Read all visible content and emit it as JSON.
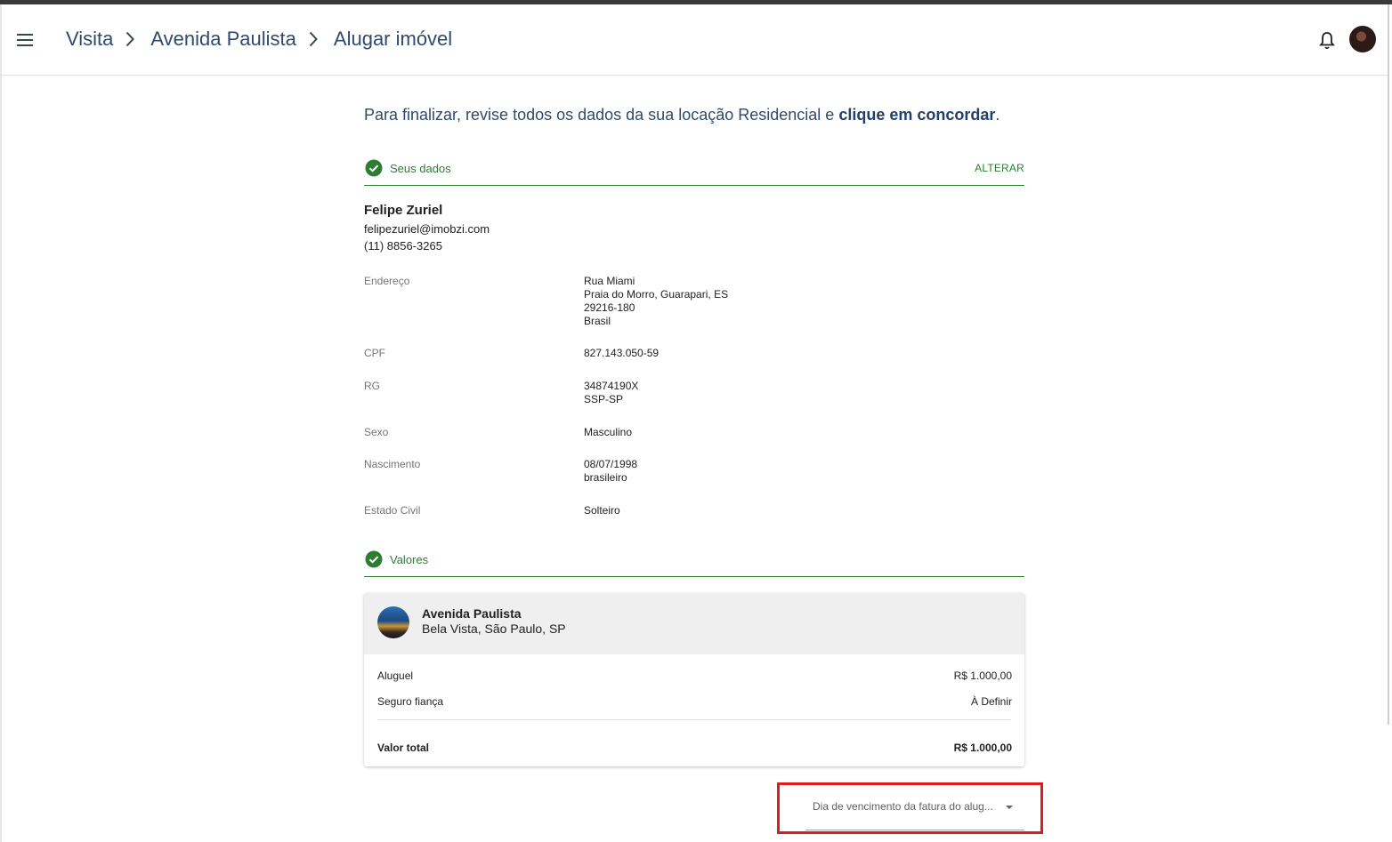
{
  "header": {
    "breadcrumb": [
      "Visita",
      "Avenida Paulista",
      "Alugar imóvel"
    ]
  },
  "intro": {
    "text": "Para finalizar, revise todos os dados da sua locação Residencial e ",
    "emphasis": "clique em concordar",
    "suffix": "."
  },
  "section_personal": {
    "title": "Seus dados",
    "action": "ALTERAR"
  },
  "user": {
    "name": "Felipe Zuriel",
    "email": "felipezuriel@imobzi.com",
    "phone": "(11) 8856-3265"
  },
  "fields": {
    "address_label": "Endereço",
    "address_line1": "Rua Miami",
    "address_line2": "Praia do Morro, Guarapari, ES",
    "address_line3": "29216-180",
    "address_line4": "Brasil",
    "cpf_label": "CPF",
    "cpf_value": "827.143.050-59",
    "rg_label": "RG",
    "rg_value": "34874190X",
    "rg_issuer": "SSP-SP",
    "sex_label": "Sexo",
    "sex_value": "Masculino",
    "birth_label": "Nascimento",
    "birth_value": "08/07/1998",
    "nationality": "brasileiro",
    "civil_label": "Estado Civil",
    "civil_value": "Solteiro"
  },
  "section_values": {
    "title": "Valores"
  },
  "property": {
    "name": "Avenida Paulista",
    "address": "Bela Vista, São Paulo, SP"
  },
  "values": {
    "rent_label": "Aluguel",
    "rent_value": "R$ 1.000,00",
    "insurance_label": "Seguro fiança",
    "insurance_value": "À Definir",
    "total_label": "Valor total",
    "total_value": "R$ 1.000,00"
  },
  "due_day_select": {
    "label": "Dia de vencimento da fatura do alug..."
  },
  "colors": {
    "accent_green": "#2e7d32",
    "breadcrumb_blue": "#2f4a6d",
    "highlight_red": "#e01b1b"
  }
}
